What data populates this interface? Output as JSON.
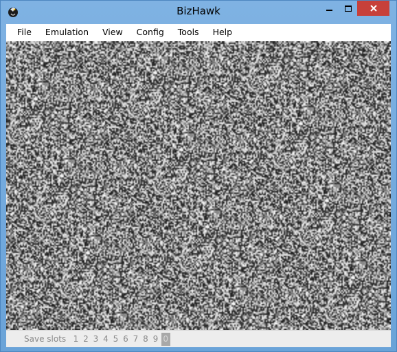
{
  "window": {
    "title": "BizHawk",
    "icon": "bizhawk-app-icon",
    "close_color": "#c7403a",
    "frame_color": "#6fa8dc"
  },
  "menu": {
    "items": [
      {
        "label": "File"
      },
      {
        "label": "Emulation"
      },
      {
        "label": "View"
      },
      {
        "label": "Config"
      },
      {
        "label": "Tools"
      },
      {
        "label": "Help"
      }
    ]
  },
  "screen": {
    "content": "static-noise"
  },
  "statusbar": {
    "save_slots_label": "Save slots",
    "slots": [
      "1",
      "2",
      "3",
      "4",
      "5",
      "6",
      "7",
      "8",
      "9",
      "0"
    ],
    "active_slot": "0"
  }
}
